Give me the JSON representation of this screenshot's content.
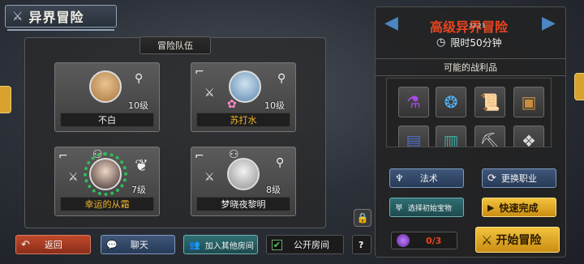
{
  "header": {
    "title": "异界冒险"
  },
  "team": {
    "header": "冒险队伍",
    "members": [
      {
        "name": "不白",
        "level": "10级",
        "name_color": "#f1f1f1"
      },
      {
        "name": "苏打水",
        "level": "10级",
        "name_color": "#f2b52a"
      },
      {
        "name": "幸运的从霜",
        "level": "7级",
        "name_color": "#f2b52a"
      },
      {
        "name": "梦晓夜黎明",
        "level": "8级",
        "name_color": "#f1f1f1"
      }
    ]
  },
  "bottom": {
    "back": "返回",
    "chat": "聊天",
    "join": "加入其他房间",
    "public_room": "公开房间",
    "public_checked": true,
    "help": "?"
  },
  "adventure": {
    "title": "高级异界冒险",
    "clock_overlay": "22:23",
    "time_limit": "限时50分钟",
    "loot_label": "可能的战利品",
    "loot_icons": [
      "purple-potion-icon",
      "blue-orb-icon",
      "scroll-icon",
      "treasure-chest-icon",
      "blue-chest-icon",
      "teal-chest-icon",
      "pickaxe-icon",
      "mask-icon"
    ],
    "buttons": {
      "magic": "法术",
      "change_job": "更换职业",
      "choose_treasure": "选择初始宝物",
      "quick_finish": "快速完成",
      "counter": "0/3",
      "start": "开始冒险"
    }
  },
  "colors": {
    "accent_red": "#e8451f",
    "gold": "#f2b52a",
    "arrow_blue": "#4a86c2"
  }
}
